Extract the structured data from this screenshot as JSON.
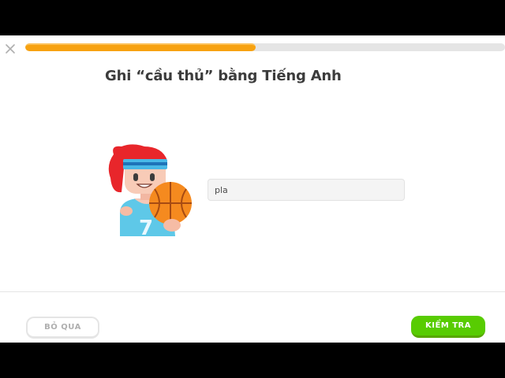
{
  "lesson": {
    "progress_fraction": 0.48,
    "progress_color": "#f7a211",
    "close_icon": "close-icon"
  },
  "prompt": {
    "text": "Ghi “cầu thủ” bằng Tiếng Anh"
  },
  "character": {
    "icon": "basketball-player-illustration"
  },
  "answer": {
    "value": "pla"
  },
  "footer": {
    "skip_label": "BỎ QUA",
    "check_label": "KIỂM TRA",
    "check_color": "#58cc02"
  }
}
